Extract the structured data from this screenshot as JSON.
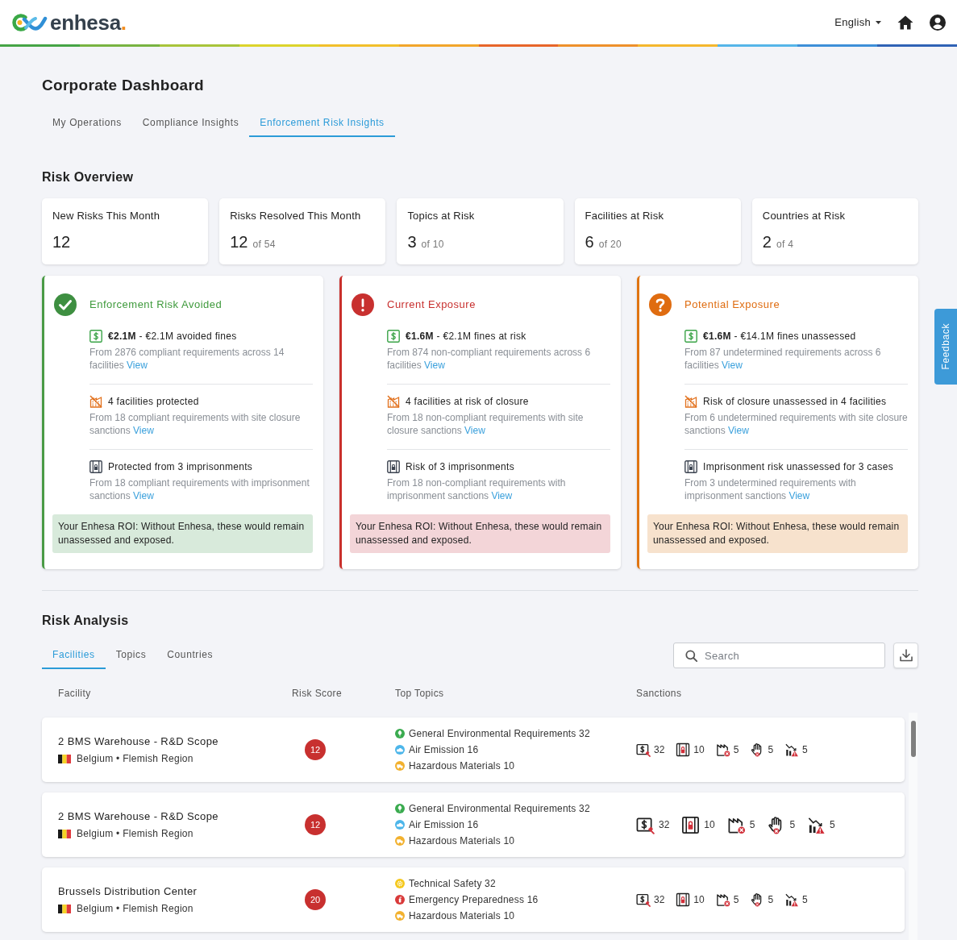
{
  "header": {
    "logo": {
      "wordmark": "enhesa",
      "dot": "."
    },
    "language": "English"
  },
  "page_title": "Corporate Dashboard",
  "tabs": [
    {
      "label": "My Operations",
      "selected": false
    },
    {
      "label": "Compliance Insights",
      "selected": false
    },
    {
      "label": "Enforcement Risk Insights",
      "selected": true
    }
  ],
  "risk_overview": {
    "title": "Risk Overview",
    "stats": [
      {
        "label": "New Risks This Month",
        "value": "12"
      },
      {
        "label": "Risks Resolved This Month",
        "value": "12",
        "total": "of 54"
      },
      {
        "label": "Topics at Risk",
        "value": "3",
        "total": "of 10"
      },
      {
        "label": "Facilities at Risk",
        "value": "6",
        "total": "of 20"
      },
      {
        "label": "Countries at Risk",
        "value": "2",
        "total": "of 4"
      }
    ],
    "cards": [
      {
        "kind": "avoided",
        "title": "Enforcement Risk Avoided",
        "items": [
          {
            "kind": "fines",
            "headline": "**€2.1M** - €2.1M avoided fines",
            "detail": "From 2876 compliant requirements across 14 facilities",
            "link": "View"
          },
          {
            "kind": "closure",
            "headline": "4 facilities protected",
            "detail": "From 18 compliant requirements with site closure sanctions",
            "link": "View"
          },
          {
            "kind": "imprisonment",
            "headline": "Protected from 3 imprisonments",
            "detail": "From 18 compliant requirements with imprisonment sanctions",
            "link": "View"
          }
        ],
        "note": "Your Enhesa ROI: Without Enhesa, these would remain unassessed and exposed."
      },
      {
        "kind": "current",
        "title": "Current Exposure",
        "items": [
          {
            "kind": "fines",
            "headline": "**€1.6M** - €2.1M fines at risk",
            "detail": "From 874 non-compliant requirements across 6 facilities",
            "link": "View"
          },
          {
            "kind": "closure",
            "headline": "4 facilities at risk of closure",
            "detail": "From 18 non-compliant requirements with site closure sanctions",
            "link": "View"
          },
          {
            "kind": "imprisonment",
            "headline": "Risk of 3 imprisonments",
            "detail": "From 18 non-compliant requirements with imprisonment sanctions",
            "link": "View"
          }
        ],
        "note": "Your Enhesa ROI: Without Enhesa, these would remain unassessed and exposed."
      },
      {
        "kind": "potential",
        "title": "Potential Exposure",
        "items": [
          {
            "kind": "fines",
            "headline": "**€1.6M** - €14.1M fines unassessed",
            "detail": "From 87 undetermined requirements across 6 facilities",
            "link": "View"
          },
          {
            "kind": "closure",
            "headline": "Risk of closure unassessed in 4 facilities",
            "detail": "From 6 undetermined requirements with site closure sanctions",
            "link": "View"
          },
          {
            "kind": "imprisonment",
            "headline": "Imprisonment risk unassessed for 3 cases",
            "detail": "From 3 undetermined requirements with imprisonment sanctions",
            "link": "View"
          }
        ],
        "note": "Your Enhesa ROI: Without Enhesa, these would remain unassessed and exposed."
      }
    ]
  },
  "risk_analysis": {
    "title": "Risk Analysis",
    "tabs": [
      {
        "label": "Facilities",
        "selected": true
      },
      {
        "label": "Topics",
        "selected": false
      },
      {
        "label": "Countries",
        "selected": false
      }
    ],
    "search": {
      "placeholder": "Search"
    },
    "columns": [
      "Facility",
      "Risk Score",
      "Top Topics",
      "Sanctions"
    ],
    "rows": [
      {
        "facility": "2 BMS Warehouse - R&D Scope",
        "location": "Belgium • Flemish Region",
        "risk_score": "12",
        "hovered": false,
        "topics": [
          {
            "kind": "environment",
            "label": "General Environmental Requirements 32",
            "color": "#3aab4f"
          },
          {
            "kind": "air",
            "label": "Air Emission 16",
            "color": "#4db6ea"
          },
          {
            "kind": "hazmat",
            "label": "Hazardous Materials 10",
            "color": "#f2b12e"
          }
        ],
        "sanctions": [
          {
            "kind": "fines",
            "count": "32"
          },
          {
            "kind": "imprisonment",
            "count": "10"
          },
          {
            "kind": "closure",
            "count": "5"
          },
          {
            "kind": "stop",
            "count": "5"
          },
          {
            "kind": "decline",
            "count": "5"
          }
        ]
      },
      {
        "facility": "2 BMS Warehouse - R&D Scope",
        "location": "Belgium • Flemish Region",
        "risk_score": "12",
        "hovered": true,
        "topics": [
          {
            "kind": "environment",
            "label": "General Environmental Requirements 32",
            "color": "#3aab4f"
          },
          {
            "kind": "air",
            "label": "Air Emission 16",
            "color": "#4db6ea"
          },
          {
            "kind": "hazmat",
            "label": "Hazardous Materials 10",
            "color": "#f2b12e"
          }
        ],
        "sanctions": [
          {
            "kind": "fines",
            "count": "32"
          },
          {
            "kind": "imprisonment",
            "count": "10"
          },
          {
            "kind": "closure",
            "count": "5"
          },
          {
            "kind": "stop",
            "count": "5"
          },
          {
            "kind": "decline",
            "count": "5"
          }
        ]
      },
      {
        "facility": "Brussels Distribution Center",
        "location": "Belgium • Flemish Region",
        "risk_score": "20",
        "hovered": false,
        "topics": [
          {
            "kind": "safety",
            "label": "Technical Safety 32",
            "color": "#f5c81c"
          },
          {
            "kind": "emergency",
            "label": "Emergency Preparedness 16",
            "color": "#d93a3a"
          },
          {
            "kind": "hazmat",
            "label": "Hazardous Materials 10",
            "color": "#f2b12e"
          }
        ],
        "sanctions": [
          {
            "kind": "fines",
            "count": "32"
          },
          {
            "kind": "imprisonment",
            "count": "10"
          },
          {
            "kind": "closure",
            "count": "5"
          },
          {
            "kind": "stop",
            "count": "5"
          },
          {
            "kind": "decline",
            "count": "5"
          }
        ]
      }
    ]
  },
  "feedback": "Feedback"
}
